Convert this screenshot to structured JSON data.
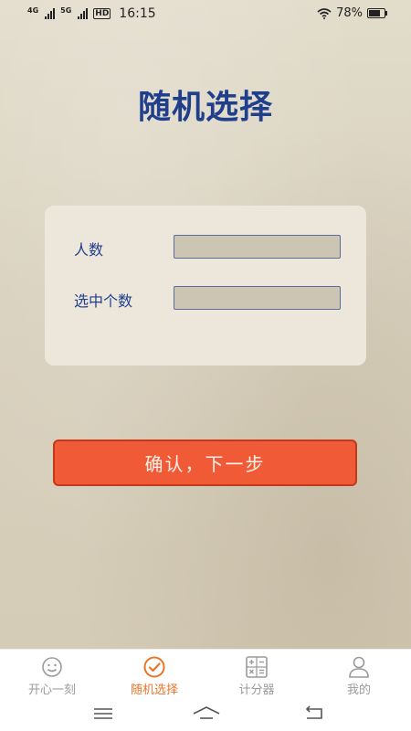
{
  "status": {
    "network1": "4G",
    "network2": "5G",
    "hd": "HD",
    "time": "16:15",
    "battery_text": "78%",
    "battery_level": 0.78
  },
  "page": {
    "title": "随机选择"
  },
  "form": {
    "people_label": "人数",
    "people_value": "",
    "selected_label": "选中个数",
    "selected_value": ""
  },
  "actions": {
    "confirm_label": "确认，下一步"
  },
  "tabs": [
    {
      "label": "开心一刻",
      "icon": "smile-face-icon",
      "active": false
    },
    {
      "label": "随机选择",
      "icon": "check-circle-icon",
      "active": true
    },
    {
      "label": "计分器",
      "icon": "calculator-icon",
      "active": false
    },
    {
      "label": "我的",
      "icon": "user-icon",
      "active": false
    }
  ],
  "colors": {
    "accent": "#e8762a",
    "title": "#1f3e8c",
    "button": "#f15a36"
  }
}
